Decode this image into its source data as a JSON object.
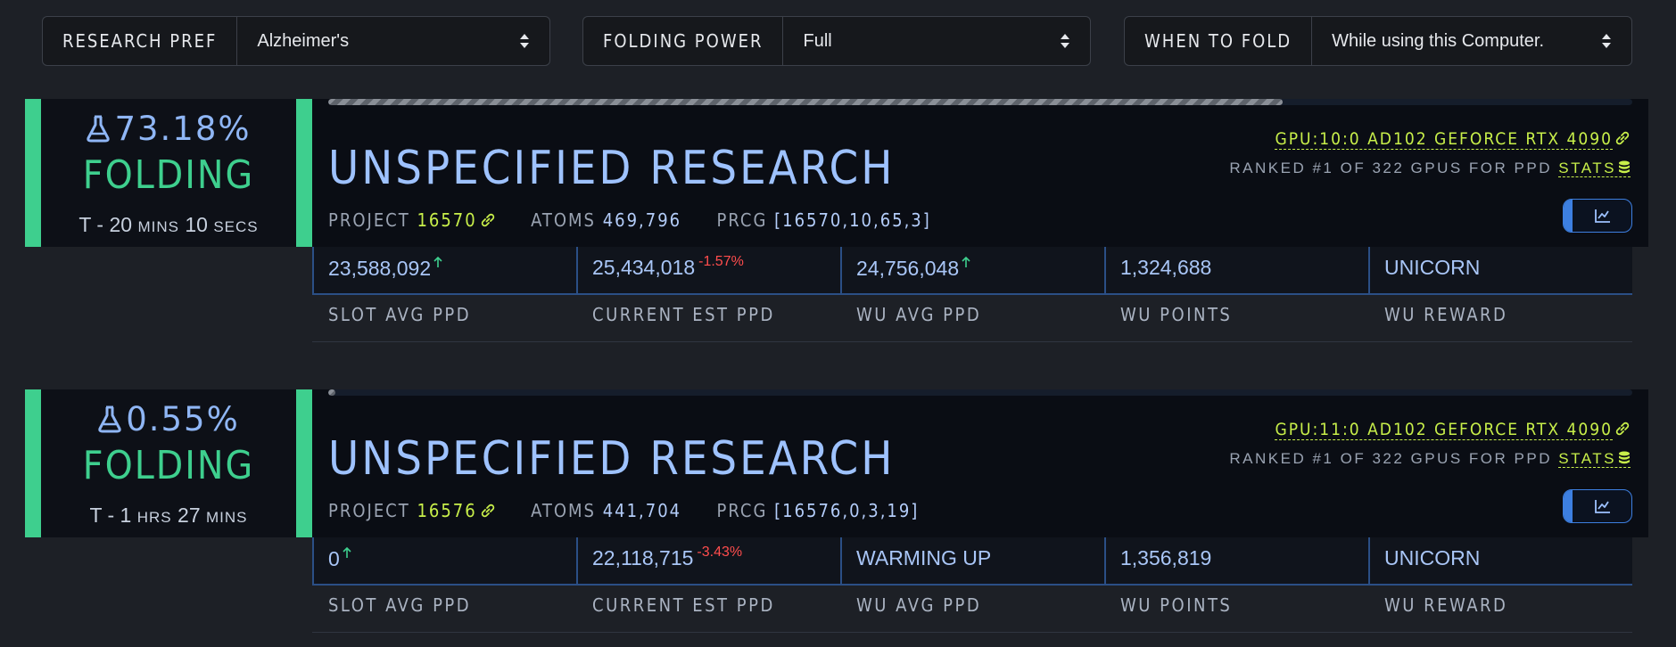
{
  "controls": {
    "research_pref": {
      "label": "RESEARCH PREF",
      "value": "Alzheimer's"
    },
    "folding_power": {
      "label": "FOLDING POWER",
      "value": "Full"
    },
    "when_to_fold": {
      "label": "WHEN TO FOLD",
      "value": "While using this Computer."
    }
  },
  "captions": {
    "slot_avg": "SLOT AVG PPD",
    "current_est": "CURRENT EST PPD",
    "wu_avg": "WU AVG PPD",
    "wu_points": "WU POINTS",
    "wu_reward": "WU REWARD"
  },
  "slots": [
    {
      "percent": "73.18%",
      "progress": 0.7318,
      "state": "FOLDING",
      "eta": {
        "prefix": "T - ",
        "n1": "20",
        "u1": "MINS",
        "n2": "10",
        "u2": "SECS"
      },
      "title": "UNSPECIFIED RESEARCH",
      "project_label": "PROJECT",
      "project": "16570",
      "atoms_label": "ATOMS",
      "atoms": "469,796",
      "prcg_label": "PRCG",
      "prcg": "[16570,10,65,3]",
      "gpu": "GPU:10:0 AD102 GEFORCE RTX 4090",
      "rank_text": "RANKED #1 OF 322 GPUS FOR PPD",
      "stats_label": "STATS",
      "slot_avg": "23,588,092",
      "current_est": "25,434,018",
      "current_delta": "-1.57%",
      "wu_avg": "24,756,048",
      "wu_points": "1,324,688",
      "wu_reward": "UNICORN"
    },
    {
      "percent": "0.55%",
      "progress": 0.0055,
      "state": "FOLDING",
      "eta": {
        "prefix": "T - ",
        "n1": "1",
        "u1": "HRS",
        "n2": "27",
        "u2": "MINS"
      },
      "title": "UNSPECIFIED RESEARCH",
      "project_label": "PROJECT",
      "project": "16576",
      "atoms_label": "ATOMS",
      "atoms": "441,704",
      "prcg_label": "PRCG",
      "prcg": "[16576,0,3,19]",
      "gpu": "GPU:11:0 AD102 GEFORCE RTX 4090",
      "rank_text": "RANKED #1 OF 322 GPUS FOR PPD",
      "stats_label": "STATS",
      "slot_avg": "0",
      "current_est": "22,118,715",
      "current_delta": "-3.43%",
      "wu_avg": "WARMING UP",
      "wu_points": "1,356,819",
      "wu_reward": "UNICORN"
    }
  ],
  "colors": {
    "accent_green": "#3ecf8e",
    "lime": "#c8ef4a",
    "blue": "#9ec2ff",
    "down_red": "#ff4d4d"
  },
  "icons": [
    "flask-icon",
    "link-icon",
    "database-icon",
    "line-chart-icon",
    "select-arrows-icon",
    "arrow-up-icon"
  ]
}
